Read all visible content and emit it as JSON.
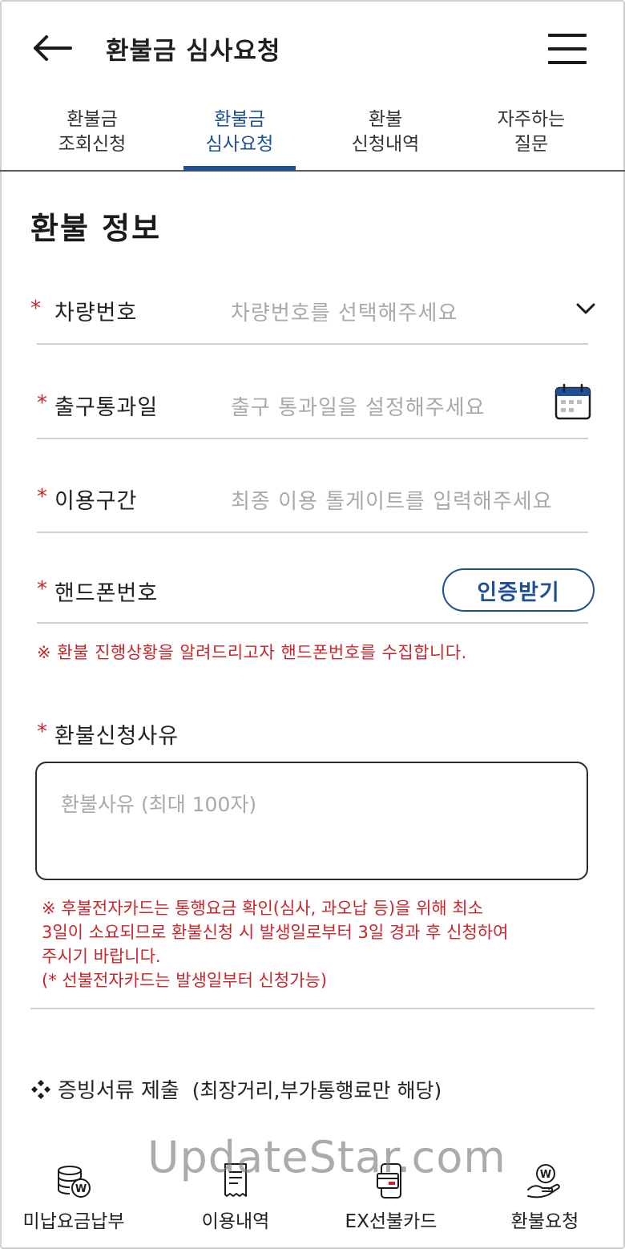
{
  "header": {
    "title": "환불금 심사요청"
  },
  "tabs": [
    {
      "label": "환불금\n조회신청"
    },
    {
      "label": "환불금\n심사요청"
    },
    {
      "label": "환불\n신청내역"
    },
    {
      "label": "자주하는\n질문"
    }
  ],
  "section": {
    "title": "환불 정보"
  },
  "fields": {
    "required_mark": "*",
    "vehicle": {
      "label": "차량번호",
      "placeholder": "차량번호를 선택해주세요"
    },
    "exit_date": {
      "label": "출구통과일",
      "placeholder": "출구 통과일을 설정해주세요"
    },
    "section_used": {
      "label": "이용구간",
      "placeholder": "최종 이용 톨게이트를 입력해주세요"
    },
    "phone": {
      "label": "핸드폰번호",
      "button": "인증받기"
    },
    "reason": {
      "label": "환불신청사유",
      "placeholder": "환불사유 (최대 100자)"
    }
  },
  "notices": {
    "phone_notice": "※ 환불 진행상황을 알려드리고자 핸드폰번호를 수집합니다.",
    "card_notice_lines": [
      "※ 후불전자카드는 통행요금 확인(심사, 과오납 등)을 위해 최소",
      "3일이 소요되므로 환불신청 시 발생일로부터 3일 경과 후 신청하여",
      "주시기 바랍니다.",
      "(* 선불전자카드는 발생일부터 신청가능)"
    ]
  },
  "evidence": {
    "title": "증빙서류 제출",
    "note": "(최장거리,부가통행료만 해당)"
  },
  "bottom_nav": [
    {
      "label": "미납요금납부",
      "icon": "coins-won-icon"
    },
    {
      "label": "이용내역",
      "icon": "receipt-icon"
    },
    {
      "label": "EX선불카드",
      "icon": "prepaid-card-icon"
    },
    {
      "label": "환불요청",
      "icon": "refund-hand-icon"
    }
  ],
  "watermark": "UpdateStar.com",
  "colors": {
    "accent": "#1f4f97",
    "required": "#c8262b",
    "placeholder": "#a9a9a9"
  }
}
